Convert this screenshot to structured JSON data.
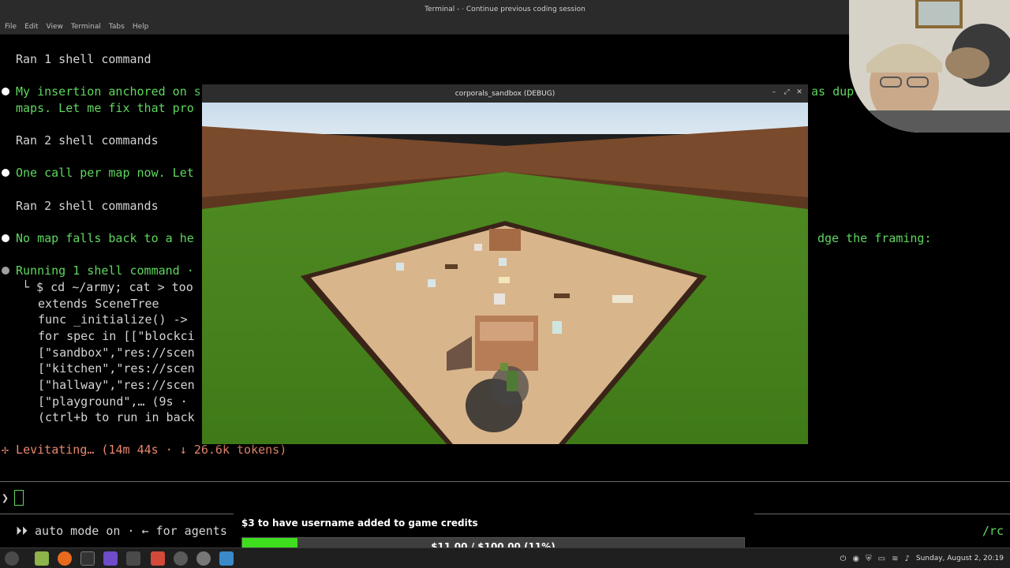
{
  "terminal": {
    "title": "Terminal - · Continue previous coding session",
    "menu": [
      "File",
      "Edit",
      "View",
      "Terminal",
      "Tabs",
      "Help"
    ],
    "lines": {
      "ran1": "Ran 1 shell command",
      "insertion_a": "My insertion anchored on s",
      "insertion_b": "as dupli",
      "maps_fix": "maps. Let me fix that pro",
      "ran2a": "Ran 2 shell commands",
      "one_call": "One call per map now. Let",
      "ran2b": "Ran 2 shell commands",
      "no_map": "No map falls back to a he",
      "no_map_b": "dge the framing:",
      "running": "Running 1 shell command ·",
      "cmd": "└ $ cd ~/army; cat > too",
      "extends": "extends SceneTree",
      "func": "func _initialize() ->",
      "for_spec": "for spec in [[\"blockci",
      "sandbox": "[\"sandbox\",\"res://scen",
      "kitchen": "[\"kitchen\",\"res://scen",
      "hallway": "[\"hallway\",\"res://scen",
      "playground": "[\"playground\",… (9s · ",
      "ctrlb": "(ctrl+b to run in back",
      "levitating": "✢ Levitating… (14m 44s · ↓ 26.6k tokens)"
    },
    "prompt": "❯",
    "auto_mode": "⏵⏵ auto mode on · ← for agents",
    "rc": "/rc"
  },
  "game": {
    "title": "corporals_sandbox (DEBUG)",
    "controls": [
      "–",
      "⤢",
      "✕"
    ]
  },
  "donation": {
    "title": "$3 to have username added to game credits",
    "progress_text": "$11.00 / $100.00 (11%)",
    "current": 11.0,
    "goal": 100.0,
    "fraction": 0.11
  },
  "taskbar": {
    "clock": "Sunday, August  2, 20:19",
    "icons": [
      "menu-icon",
      "files-icon",
      "firefox-icon",
      "terminal-icon",
      "obs-icon",
      "editor-icon",
      "pdf-icon",
      "godot-icon",
      "settings-icon",
      "chrome-icon"
    ]
  }
}
